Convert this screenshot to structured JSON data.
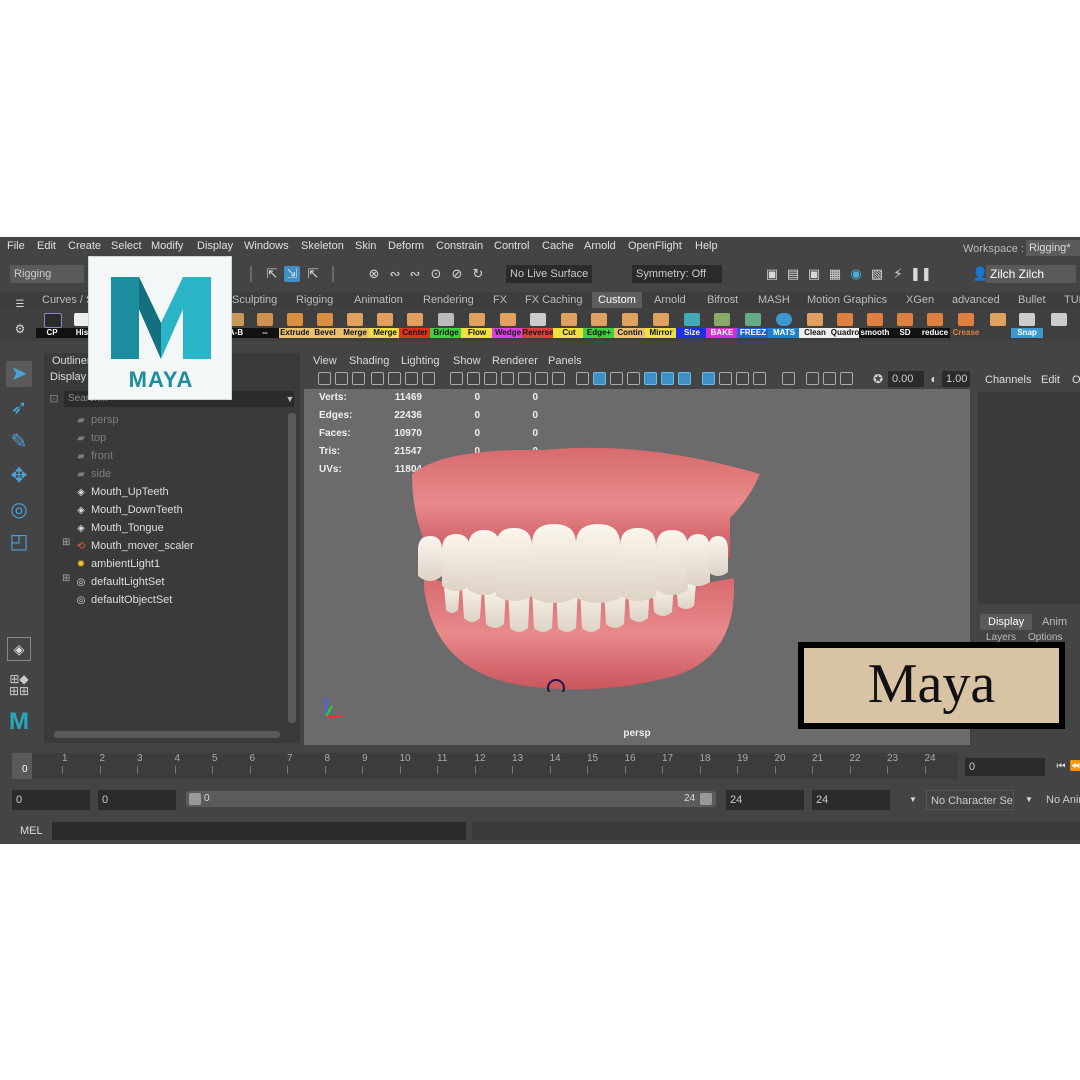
{
  "menubar": {
    "items": [
      "File",
      "Edit",
      "Create",
      "Select",
      "Modify",
      "Display",
      "Windows",
      "Skeleton",
      "Skin",
      "Deform",
      "Constrain",
      "Control",
      "Cache",
      "Arnold",
      "OpenFlight",
      "Help"
    ],
    "workspace_label": "Workspace :",
    "workspace_value": "Rigging*"
  },
  "statusline": {
    "menu_set": "Rigging",
    "live_surface": "No Live Surface",
    "symmetry": "Symmetry: Off",
    "user": "Zilch Zilch"
  },
  "shelf": {
    "tabs": [
      "Curves / S",
      "Sculpting",
      "Rigging",
      "Animation",
      "Rendering",
      "FX",
      "FX Caching",
      "Custom",
      "Arnold",
      "Bifrost",
      "MASH",
      "Motion Graphics",
      "XGen",
      "advanced",
      "Bullet",
      "TUR"
    ],
    "active_tab": "Custom",
    "buttons": [
      "CP",
      "His",
      "A-B",
      "--",
      "Extrude",
      "Bevel",
      "Merge",
      "Merge",
      "Center",
      "Bridge",
      "Flow",
      "Wedge",
      "Reverse",
      "Cut",
      "Edge+",
      "Contin",
      "Mirror",
      "Size",
      "BAKE",
      "FREEZ",
      "MATS",
      "Clean",
      "Quadro",
      "smooth",
      "SD",
      "reduce",
      "Crease",
      "Snap"
    ]
  },
  "outliner": {
    "title": "Outliner",
    "display_menu": "Display",
    "search_placeholder": "Search...",
    "items": [
      {
        "label": "persp",
        "dim": true
      },
      {
        "label": "top",
        "dim": true
      },
      {
        "label": "front",
        "dim": true
      },
      {
        "label": "side",
        "dim": true
      },
      {
        "label": "Mouth_UpTeeth",
        "dim": false
      },
      {
        "label": "Mouth_DownTeeth",
        "dim": false
      },
      {
        "label": "Mouth_Tongue",
        "dim": false
      },
      {
        "label": "Mouth_mover_scaler",
        "dim": false
      },
      {
        "label": "ambientLight1",
        "dim": false
      },
      {
        "label": "defaultLightSet",
        "dim": false
      },
      {
        "label": "defaultObjectSet",
        "dim": false
      }
    ]
  },
  "viewport": {
    "menus": [
      "View",
      "Shading",
      "Lighting",
      "Show",
      "Renderer",
      "Panels"
    ],
    "exposure": "0.00",
    "gamma": "1.00",
    "camera": "persp",
    "hud": [
      {
        "label": "Verts:",
        "v1": "11469",
        "v2": "0",
        "v3": "0"
      },
      {
        "label": "Edges:",
        "v1": "22436",
        "v2": "0",
        "v3": "0"
      },
      {
        "label": "Faces:",
        "v1": "10970",
        "v2": "0",
        "v3": "0"
      },
      {
        "label": "Tris:",
        "v1": "21547",
        "v2": "0",
        "v3": "0"
      },
      {
        "label": "UVs:",
        "v1": "11804",
        "v2": "0",
        "v3": "0"
      }
    ]
  },
  "channelbox": {
    "menus": [
      "Channels",
      "Edit",
      "O"
    ],
    "layer_tabs": [
      "Display",
      "Anim"
    ],
    "layer_menus": [
      "Layers",
      "Options"
    ]
  },
  "timeslider": {
    "ticks": [
      "1",
      "2",
      "3",
      "4",
      "5",
      "6",
      "7",
      "8",
      "9",
      "10",
      "11",
      "12",
      "13",
      "14",
      "15",
      "16",
      "17",
      "18",
      "19",
      "20",
      "21",
      "22",
      "23",
      "24"
    ],
    "current_frame": "0",
    "current_time_field": "0"
  },
  "rangeslider": {
    "start_time": "0",
    "range_start": "0",
    "range_inner_start": "0",
    "range_inner_end": "24",
    "range_end": "24",
    "end_time": "24",
    "character_set": "No Character Set",
    "anim_layer": "No Anim"
  },
  "cmdline": {
    "language": "MEL"
  },
  "logo": {
    "text": "MAYA",
    "color": "#1e8da0"
  },
  "badge": {
    "text": "Maya",
    "color": "#d8c3a5"
  }
}
